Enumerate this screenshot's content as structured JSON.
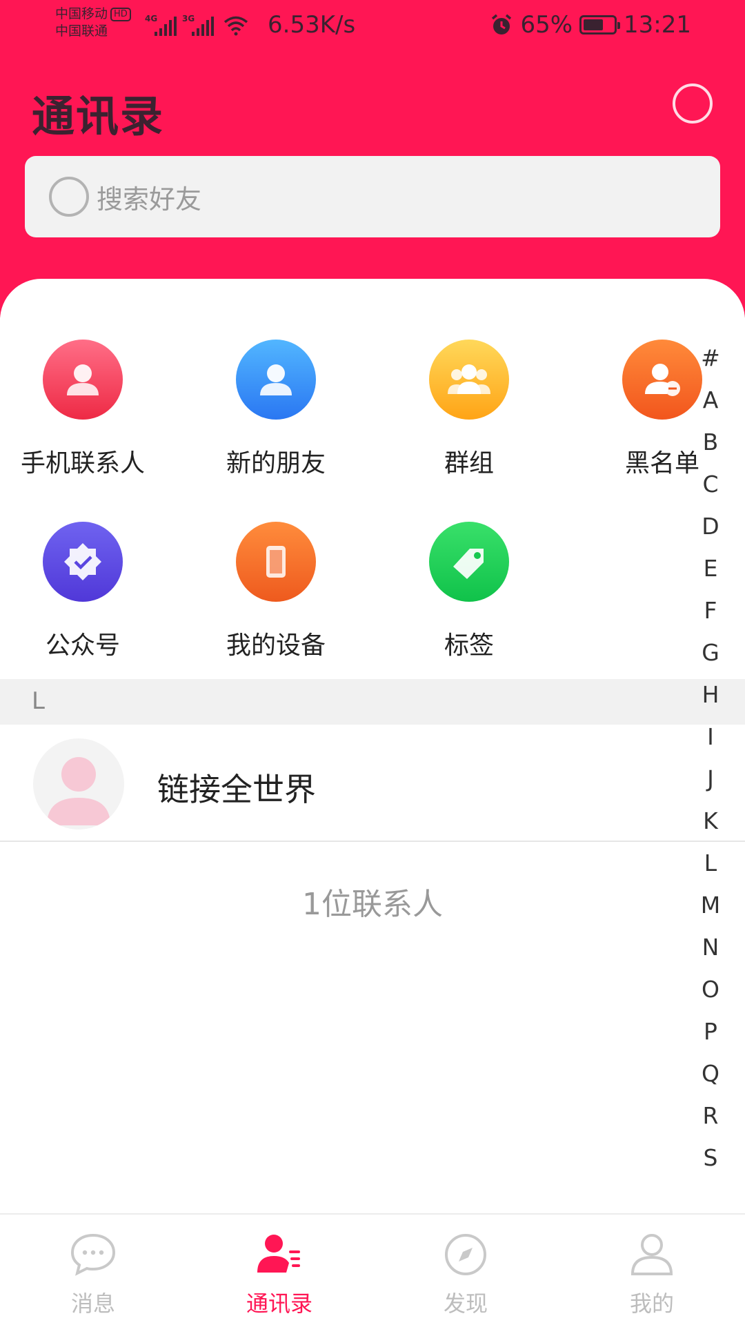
{
  "status_bar": {
    "carrier_1": "中国移动",
    "hd_badge": "HD",
    "carrier_2": "中国联通",
    "network_1": "4G",
    "network_2": "3G",
    "net_speed": "6.53K/s",
    "battery": "65%",
    "time": "13:21"
  },
  "header": {
    "title": "通讯录",
    "search_placeholder": "搜索好友"
  },
  "colors": {
    "brand": "#FF1654",
    "inactive": "#BDBDBD"
  },
  "shortcuts": [
    {
      "label": "手机联系人",
      "icon": "person-icon"
    },
    {
      "label": "新的朋友",
      "icon": "person-icon"
    },
    {
      "label": "群组",
      "icon": "group-icon"
    },
    {
      "label": "黑名单",
      "icon": "person-minus-icon"
    },
    {
      "label": "公众号",
      "icon": "verified-badge-icon"
    },
    {
      "label": "我的设备",
      "icon": "phone-device-icon"
    },
    {
      "label": "标签",
      "icon": "tag-icon"
    }
  ],
  "section": {
    "letter": "L"
  },
  "contacts": [
    {
      "name": "链接全世界"
    }
  ],
  "contact_count": "1位联系人",
  "alphabet_index": [
    "#",
    "A",
    "B",
    "C",
    "D",
    "E",
    "F",
    "G",
    "H",
    "I",
    "J",
    "K",
    "L",
    "M",
    "N",
    "O",
    "P",
    "Q",
    "R",
    "S"
  ],
  "bottom_nav": [
    {
      "label": "消息",
      "icon": "chat-bubble-icon",
      "active": false
    },
    {
      "label": "通讯录",
      "icon": "contacts-icon",
      "active": true
    },
    {
      "label": "发现",
      "icon": "compass-icon",
      "active": false
    },
    {
      "label": "我的",
      "icon": "profile-icon",
      "active": false
    }
  ]
}
